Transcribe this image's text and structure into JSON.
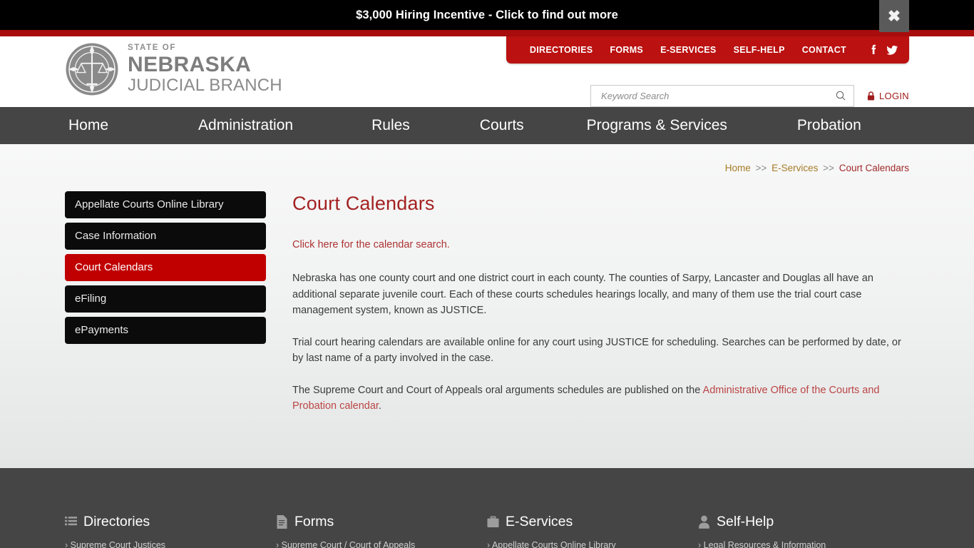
{
  "alert": {
    "message": "$3,000 Hiring Incentive - Click to find out more",
    "close_label": "✖",
    "close_icon": "close-icon",
    "background": "#000000"
  },
  "header": {
    "logo": {
      "state_of": "STATE OF",
      "nebraska": "NEBRASKA",
      "judicial_branch": "JUDICIAL BRANCH",
      "seal_icon": "scales-of-justice-seal-icon"
    },
    "utility_links": [
      "DIRECTORIES",
      "FORMS",
      "E-SERVICES",
      "SELF-HELP",
      "CONTACT"
    ],
    "social": [
      {
        "name": "facebook-icon",
        "label": "Facebook"
      },
      {
        "name": "twitter-icon",
        "label": "Twitter"
      }
    ],
    "search": {
      "placeholder": "Keyword Search",
      "value": "",
      "button_icon": "search-icon"
    },
    "login": {
      "label": "LOGIN",
      "icon": "lock-icon",
      "color": "#a01c1c"
    },
    "accent_red": "#bb1111"
  },
  "main_nav": {
    "items": [
      "Home",
      "Administration",
      "Rules",
      "Courts",
      "Programs & Services",
      "Probation"
    ],
    "background": "#454545"
  },
  "breadcrumb": {
    "items": [
      "Home",
      "E-Services",
      "Court Calendars"
    ],
    "separator": ">>"
  },
  "sidebar": {
    "items": [
      {
        "label": "Appellate Courts Online Library",
        "active": false
      },
      {
        "label": "Case Information",
        "active": false
      },
      {
        "label": "Court Calendars",
        "active": true
      },
      {
        "label": "eFiling",
        "active": false
      },
      {
        "label": "ePayments",
        "active": false
      }
    ],
    "active_color": "#c00000"
  },
  "main": {
    "title": "Court Calendars",
    "search_link": "Click here for the calendar search.",
    "paragraph_1": "Nebraska has one county court and one district court in each county.  The counties of Sarpy, Lancaster and Douglas all have an additional separate juvenile court.  Each of these courts schedules hearings locally, and many of them use the trial court case management system, known as JUSTICE.",
    "paragraph_2": "Trial court hearing calendars are available online for any court using JUSTICE for scheduling.  Searches can be performed by date, or by last name of a party involved in the case.",
    "paragraph_3_before": "The Supreme Court and Court of Appeals oral arguments schedules are published on the ",
    "paragraph_3_link": "Administrative Office of the Courts and Probation calendar",
    "paragraph_3_after": ".",
    "title_color": "#a32222"
  },
  "footer": {
    "columns": [
      {
        "heading": "Directories",
        "icon": "list-icon",
        "links": [
          "Supreme Court Justices"
        ]
      },
      {
        "heading": "Forms",
        "icon": "document-icon",
        "links": [
          "Supreme Court / Court of Appeals"
        ]
      },
      {
        "heading": "E-Services",
        "icon": "briefcase-icon",
        "links": [
          "Appellate Courts Online Library"
        ]
      },
      {
        "heading": "Self-Help",
        "icon": "person-icon",
        "links": [
          "Legal Resources & Information"
        ]
      }
    ],
    "background": "#454545"
  }
}
